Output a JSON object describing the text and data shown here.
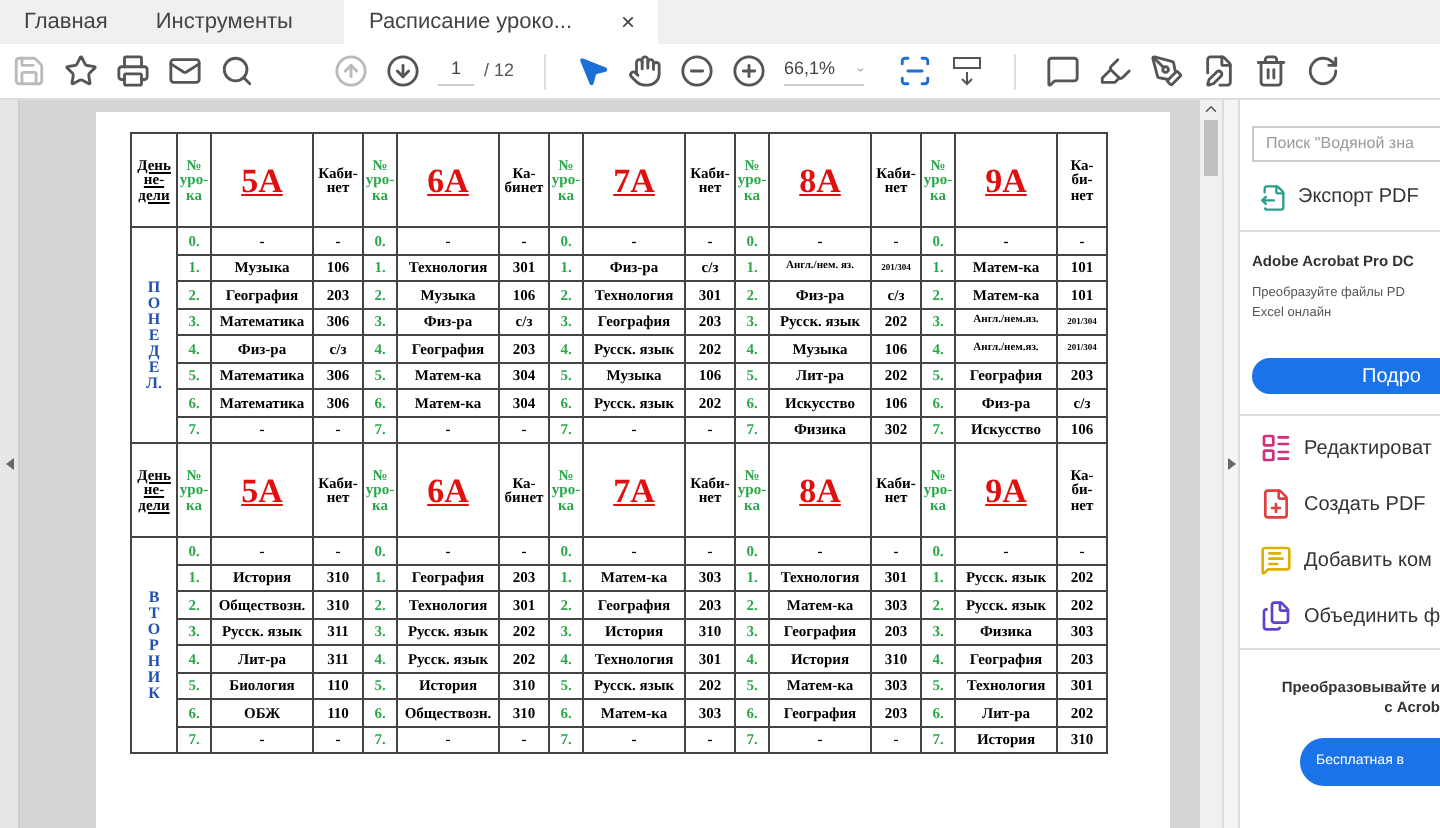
{
  "tabs": [
    {
      "label": "Главная",
      "selected": false
    },
    {
      "label": "Инструменты",
      "selected": false
    },
    {
      "label": "Расписание уроко...",
      "selected": true,
      "close": "×"
    }
  ],
  "toolbar": {
    "save_disabled": true,
    "prev_page_disabled": true,
    "page": "1",
    "page_count": "/ 12",
    "zoom": "66,1%"
  },
  "schedule": [
    {
      "day_header": [
        "День",
        "не-",
        "дели"
      ],
      "day_letters": [
        "П",
        "О",
        "Н",
        "Е",
        "Д",
        "Е",
        "Л."
      ],
      "classes": [
        {
          "name": "5А",
          "num_header": [
            "№",
            "уро-",
            "ка"
          ],
          "room_header": [
            "Каби-",
            "нет"
          ]
        },
        {
          "name": "6А",
          "num_header": [
            "№",
            "уро-",
            "ка"
          ],
          "room_header": [
            "Ка-",
            "бинет"
          ]
        },
        {
          "name": "7А",
          "num_header": [
            "№",
            "уро-",
            "ка"
          ],
          "room_header": [
            "Каби-",
            "нет"
          ]
        },
        {
          "name": "8А",
          "num_header": [
            "№",
            "уро-",
            "ка"
          ],
          "room_header": [
            "Каби-",
            "нет"
          ]
        },
        {
          "name": "9А",
          "num_header": [
            "№",
            "уро-",
            "ка"
          ],
          "room_header": [
            "Ка-",
            "би-",
            "нет"
          ]
        }
      ],
      "rows": [
        [
          [
            "0.",
            "-",
            "-"
          ],
          [
            "0.",
            "-",
            "-"
          ],
          [
            "0.",
            "-",
            "-"
          ],
          [
            "0.",
            "-",
            "-"
          ],
          [
            "0.",
            "-",
            "-"
          ]
        ],
        [
          [
            "1.",
            "Музыка",
            "106"
          ],
          [
            "1.",
            "Технология",
            "301"
          ],
          [
            "1.",
            "Физ-ра",
            "с/з"
          ],
          [
            "1.",
            "Англ./нем. яз.",
            "201/304"
          ],
          [
            "1.",
            "Матем-ка",
            "101"
          ]
        ],
        [
          [
            "2.",
            "География",
            "203"
          ],
          [
            "2.",
            "Музыка",
            "106"
          ],
          [
            "2.",
            "Технология",
            "301"
          ],
          [
            "2.",
            "Физ-ра",
            "с/з"
          ],
          [
            "2.",
            "Матем-ка",
            "101"
          ]
        ],
        [
          [
            "3.",
            "Математика",
            "306"
          ],
          [
            "3.",
            "Физ-ра",
            "с/з"
          ],
          [
            "3.",
            "География",
            "203"
          ],
          [
            "3.",
            "Русск. язык",
            "202"
          ],
          [
            "3.",
            "Англ./нем.яз.",
            "201/304"
          ]
        ],
        [
          [
            "4.",
            "Физ-ра",
            "с/з"
          ],
          [
            "4.",
            "География",
            "203"
          ],
          [
            "4.",
            "Русск. язык",
            "202"
          ],
          [
            "4.",
            "Музыка",
            "106"
          ],
          [
            "4.",
            "Англ./нем.яз.",
            "201/304"
          ]
        ],
        [
          [
            "5.",
            "Математика",
            "306"
          ],
          [
            "5.",
            "Матем-ка",
            "304"
          ],
          [
            "5.",
            "Музыка",
            "106"
          ],
          [
            "5.",
            "Лит-ра",
            "202"
          ],
          [
            "5.",
            "География",
            "203"
          ]
        ],
        [
          [
            "6.",
            "Математика",
            "306"
          ],
          [
            "6.",
            "Матем-ка",
            "304"
          ],
          [
            "6.",
            "Русск. язык",
            "202"
          ],
          [
            "6.",
            "Искусство",
            "106"
          ],
          [
            "6.",
            "Физ-ра",
            "с/з"
          ]
        ],
        [
          [
            "7.",
            "-",
            "-"
          ],
          [
            "7.",
            "-",
            "-"
          ],
          [
            "7.",
            "-",
            "-"
          ],
          [
            "7.",
            "Физика",
            "302"
          ],
          [
            "7.",
            "Искусство",
            "106"
          ]
        ]
      ]
    },
    {
      "day_header": [
        "День",
        "не-",
        "дели"
      ],
      "day_letters": [
        "В",
        "Т",
        "О",
        "Р",
        "Н",
        "И",
        "К"
      ],
      "classes": [
        {
          "name": "5А",
          "num_header": [
            "№",
            "уро-",
            "ка"
          ],
          "room_header": [
            "Каби-",
            "нет"
          ]
        },
        {
          "name": "6А",
          "num_header": [
            "№",
            "уро-",
            "ка"
          ],
          "room_header": [
            "Ка-",
            "бинет"
          ]
        },
        {
          "name": "7А",
          "num_header": [
            "№",
            "уро-",
            "ка"
          ],
          "room_header": [
            "Каби-",
            "нет"
          ]
        },
        {
          "name": "8А",
          "num_header": [
            "№",
            "уро-",
            "ка"
          ],
          "room_header": [
            "Каби-",
            "нет"
          ]
        },
        {
          "name": "9А",
          "num_header": [
            "№",
            "уро-",
            "ка"
          ],
          "room_header": [
            "Ка-",
            "би-",
            "нет"
          ]
        }
      ],
      "rows": [
        [
          [
            "0.",
            "-",
            "-"
          ],
          [
            "0.",
            "-",
            "-"
          ],
          [
            "0.",
            "-",
            "-"
          ],
          [
            "0.",
            "-",
            "-"
          ],
          [
            "0.",
            "-",
            "-"
          ]
        ],
        [
          [
            "1.",
            "История",
            "310"
          ],
          [
            "1.",
            "География",
            "203"
          ],
          [
            "1.",
            "Матем-ка",
            "303"
          ],
          [
            "1.",
            "Технология",
            "301"
          ],
          [
            "1.",
            "Русск. язык",
            "202"
          ]
        ],
        [
          [
            "2.",
            "Обществозн.",
            "310"
          ],
          [
            "2.",
            "Технология",
            "301"
          ],
          [
            "2.",
            "География",
            "203"
          ],
          [
            "2.",
            "Матем-ка",
            "303"
          ],
          [
            "2.",
            "Русск. язык",
            "202"
          ]
        ],
        [
          [
            "3.",
            "Русск. язык",
            "311"
          ],
          [
            "3.",
            "Русск. язык",
            "202"
          ],
          [
            "3.",
            "История",
            "310"
          ],
          [
            "3.",
            "География",
            "203"
          ],
          [
            "3.",
            "Физика",
            "303"
          ]
        ],
        [
          [
            "4.",
            "Лит-ра",
            "311"
          ],
          [
            "4.",
            "Русск. язык",
            "202"
          ],
          [
            "4.",
            "Технология",
            "301"
          ],
          [
            "4.",
            "История",
            "310"
          ],
          [
            "4.",
            "География",
            "203"
          ]
        ],
        [
          [
            "5.",
            "Биология",
            "110"
          ],
          [
            "5.",
            "История",
            "310"
          ],
          [
            "5.",
            "Русск. язык",
            "202"
          ],
          [
            "5.",
            "Матем-ка",
            "303"
          ],
          [
            "5.",
            "Технология",
            "301"
          ]
        ],
        [
          [
            "6.",
            "ОБЖ",
            "110"
          ],
          [
            "6.",
            "Обществозн.",
            "310"
          ],
          [
            "6.",
            "Матем-ка",
            "303"
          ],
          [
            "6.",
            "География",
            "203"
          ],
          [
            "6.",
            "Лит-ра",
            "202"
          ]
        ],
        [
          [
            "7.",
            "-",
            "-"
          ],
          [
            "7.",
            "-",
            "-"
          ],
          [
            "7.",
            "-",
            "-"
          ],
          [
            "7.",
            "-",
            "-"
          ],
          [
            "7.",
            "История",
            "310"
          ]
        ]
      ]
    }
  ],
  "right_panel": {
    "search_placeholder": "Поиск \"Водяной зна",
    "export": "Экспорт PDF",
    "promo_title": "Adobe Acrobat Pro DC",
    "promo_text": [
      "Преобразуйте файлы PD",
      "Excel онлайн"
    ],
    "promo_button": "Подро",
    "tools": [
      "Редактироват",
      "Создать PDF",
      "Добавить ком",
      "Объединить ф"
    ],
    "bottom_text": [
      "Преобразовывайте и",
      "с Acrob"
    ],
    "bottom_button": "Бесплатная в"
  }
}
